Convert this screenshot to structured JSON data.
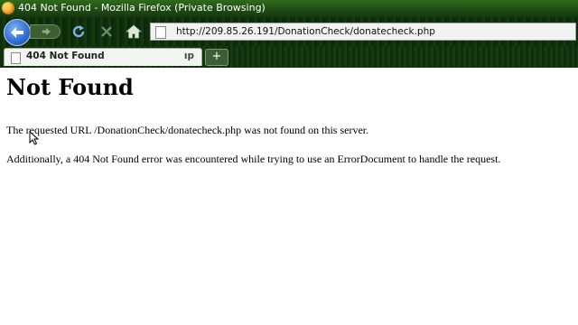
{
  "window": {
    "title": "404 Not Found - Mozilla Firefox (Private Browsing)"
  },
  "toolbar": {
    "back_icon": "back-arrow-icon",
    "forward_icon": "forward-arrow-icon",
    "reload_icon": "reload-icon",
    "stop_icon": "stop-icon",
    "home_icon": "home-icon"
  },
  "address_bar": {
    "url": "http://209.85.26.191/DonationCheck/donatecheck.php"
  },
  "tabs": [
    {
      "label": "404 Not Found",
      "tail": "ıp"
    }
  ],
  "new_tab_label": "+",
  "page": {
    "heading": "Not Found",
    "message1": "The requested URL /DonationCheck/donatecheck.php was not found on this server.",
    "message2": "Additionally, a 404 Not Found error was encountered while trying to use an ErrorDocument to handle the request."
  },
  "colors": {
    "titlebar": "#1c4512",
    "toolbar": "#123510",
    "back_button": "#2f6bd2"
  }
}
